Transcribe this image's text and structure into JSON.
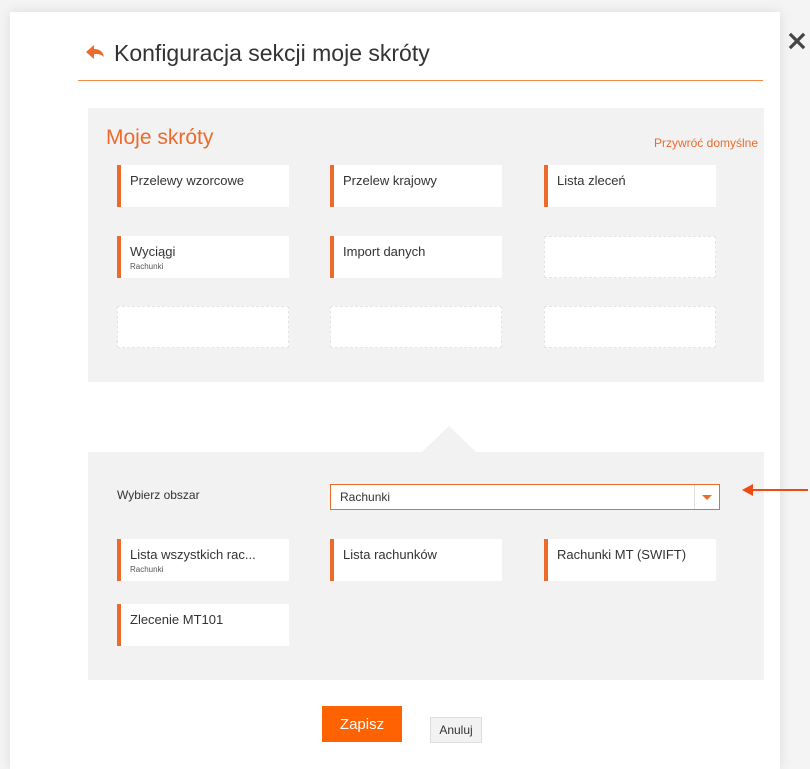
{
  "dialog": {
    "title": "Konfiguracja sekcji moje skróty"
  },
  "shortcuts": {
    "heading": "Moje skróty",
    "restore_label": "Przywróć domyślne",
    "tiles": [
      {
        "label": "Przelewy wzorcowe",
        "sub": ""
      },
      {
        "label": "Przelew krajowy",
        "sub": ""
      },
      {
        "label": "Lista zleceń",
        "sub": ""
      },
      {
        "label": "Wyciągi",
        "sub": "Rachunki"
      },
      {
        "label": "Import danych",
        "sub": ""
      }
    ]
  },
  "area": {
    "label": "Wybierz obszar",
    "selected": "Rachunki",
    "items": [
      {
        "label": "Lista wszystkich rac...",
        "sub": "Rachunki"
      },
      {
        "label": "Lista rachunków",
        "sub": ""
      },
      {
        "label": "Rachunki MT (SWIFT)",
        "sub": ""
      },
      {
        "label": "Zlecenie MT101",
        "sub": ""
      }
    ]
  },
  "buttons": {
    "save": "Zapisz",
    "cancel": "Anuluj"
  },
  "colors": {
    "accent": "#ee6a2c",
    "save_button": "#ff6200",
    "panel_bg": "#f2f2f2"
  },
  "icons": {
    "back": "back-arrow-icon",
    "close": "close-icon",
    "dropdown": "chevron-down-icon",
    "pointer": "arrow-left-icon"
  }
}
